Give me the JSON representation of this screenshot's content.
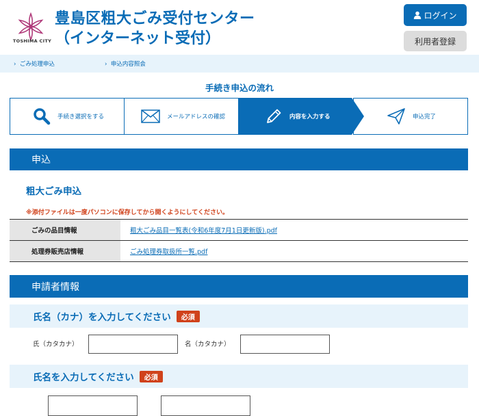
{
  "header": {
    "logo_subtext": "TOSHIMA CITY",
    "title_line1": "豊島区粗大ごみ受付センター",
    "title_line2": "（インターネット受付）",
    "login_label": "ログイン",
    "register_label": "利用者登録"
  },
  "breadcrumb": {
    "items": [
      "ごみ処理申込",
      "申込内容照会"
    ]
  },
  "flow": {
    "title": "手続き申込の流れ",
    "steps": [
      {
        "label": "手続き選択をする",
        "icon": "search-icon"
      },
      {
        "label": "メールアドレスの確認",
        "icon": "envelope-icon"
      },
      {
        "label": "内容を入力する",
        "icon": "pencil-icon",
        "active": true
      },
      {
        "label": "申込完了",
        "icon": "paper-plane-icon"
      }
    ]
  },
  "application_section": {
    "title": "申込",
    "subtitle": "粗大ごみ申込",
    "warning": "※添付ファイルは一度パソコンに保存してから開くようにしてください。",
    "rows": [
      {
        "header": "ごみの品目情報",
        "link": "粗大ごみ品目一覧表(令和6年度7月1日更新版).pdf"
      },
      {
        "header": "処理券販売店情報",
        "link": "ごみ処理券取扱所一覧.pdf"
      }
    ]
  },
  "applicant_section": {
    "title": "申請者情報",
    "kana_field": {
      "label": "氏名（カナ）を入力してください",
      "required": "必須",
      "last_label": "氏（カタカナ）",
      "first_label": "名（カタカナ）",
      "last_value": "",
      "first_value": ""
    },
    "name_field": {
      "label": "氏名を入力してください",
      "required": "必須"
    }
  },
  "colors": {
    "primary": "#0a6cb6",
    "light_band": "#e7f3fb",
    "required_badge": "#d0421b",
    "logo": "#b03a7a"
  }
}
